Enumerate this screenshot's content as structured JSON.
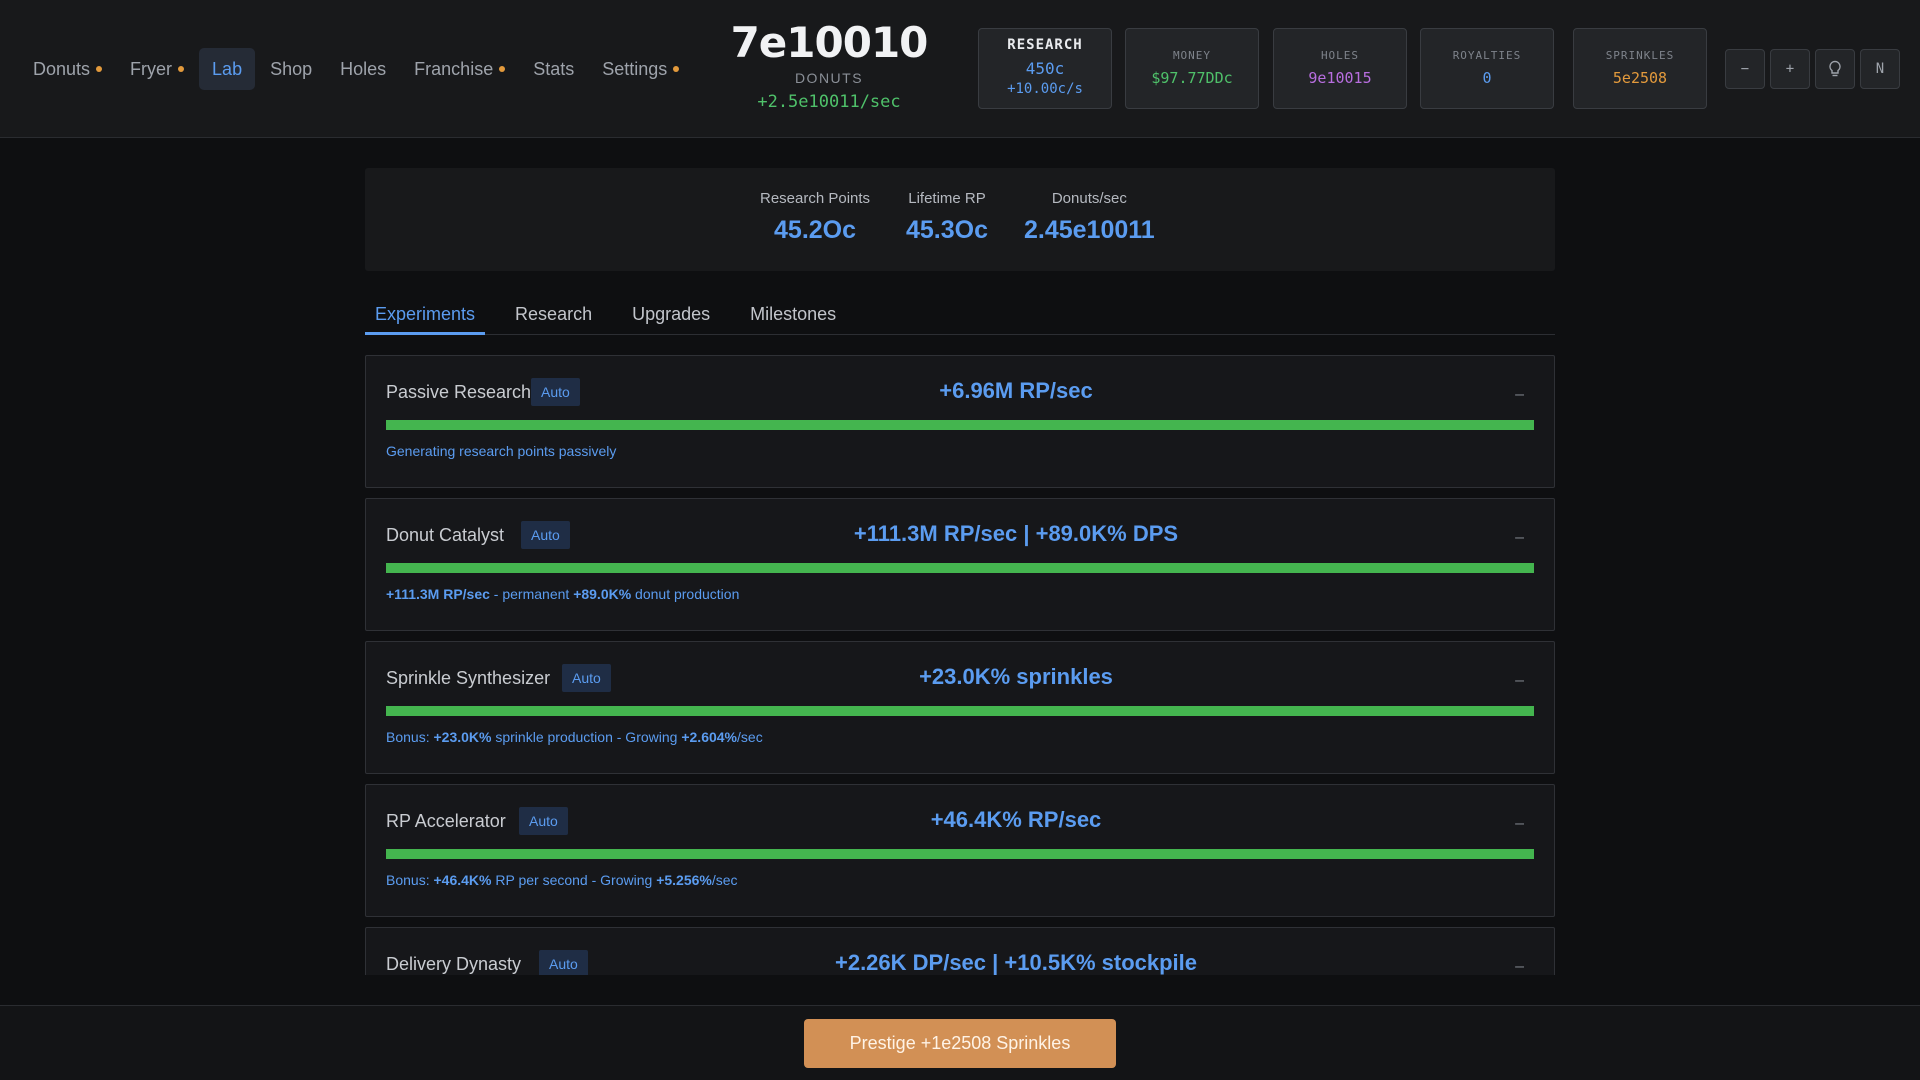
{
  "nav": [
    {
      "label": "Donuts",
      "dot": true,
      "active": false
    },
    {
      "label": "Fryer",
      "dot": true,
      "active": false
    },
    {
      "label": "Lab",
      "dot": false,
      "active": true
    },
    {
      "label": "Shop",
      "dot": false,
      "active": false
    },
    {
      "label": "Holes",
      "dot": false,
      "active": false
    },
    {
      "label": "Franchise",
      "dot": true,
      "active": false
    },
    {
      "label": "Stats",
      "dot": false,
      "active": false
    },
    {
      "label": "Settings",
      "dot": true,
      "active": false
    }
  ],
  "donuts": {
    "value": "7e10010",
    "label": "DONUTS",
    "rate": "+2.5e10011/sec"
  },
  "stats": {
    "research": {
      "label": "RESEARCH",
      "value": "450c",
      "rate": "+10.00c/s"
    },
    "money": {
      "label": "MONEY",
      "value": "$97.77DDc",
      "color": "#4fc16a"
    },
    "holes": {
      "label": "HOLES",
      "value": "9e10015",
      "color": "#b86ee0"
    },
    "royalties": {
      "label": "ROYALTIES",
      "value": "0",
      "color": "#5b9cf0"
    },
    "sprinkles": {
      "label": "SPRINKLES",
      "value": "5e2508",
      "color": "#e39a3c"
    }
  },
  "controls": [
    "−",
    "+",
    "lightbulb-icon",
    "N"
  ],
  "summary": {
    "research_points": {
      "label": "Research Points",
      "value": "45.2Oc"
    },
    "lifetime_rp": {
      "label": "Lifetime RP",
      "value": "45.3Oc"
    },
    "donuts_per_sec": {
      "label": "Donuts/sec",
      "value": "2.45e10011"
    }
  },
  "tabs": [
    {
      "label": "Experiments",
      "active": true
    },
    {
      "label": "Research",
      "active": false
    },
    {
      "label": "Upgrades",
      "active": false
    },
    {
      "label": "Milestones",
      "active": false
    }
  ],
  "experiments": [
    {
      "name": "Passive Research",
      "badge": "Auto",
      "effect": "+6.96M RP/sec",
      "progress": 1.0,
      "desc": [
        {
          "t": "Generating research points passively",
          "b": false
        }
      ]
    },
    {
      "name": "Donut Catalyst",
      "badge": "Auto",
      "effect": "+111.3M RP/sec | +89.0K% DPS",
      "progress": 1.0,
      "desc": [
        {
          "t": "+111.3M RP/sec",
          "b": true
        },
        {
          "t": " - permanent ",
          "b": false
        },
        {
          "t": "+89.0K%",
          "b": true
        },
        {
          "t": " donut production",
          "b": false
        }
      ]
    },
    {
      "name": "Sprinkle Synthesizer",
      "badge": "Auto",
      "effect": "+23.0K% sprinkles",
      "progress": 1.0,
      "desc": [
        {
          "t": "Bonus: ",
          "b": false
        },
        {
          "t": "+23.0K%",
          "b": true
        },
        {
          "t": " sprinkle production - Growing ",
          "b": false
        },
        {
          "t": "+2.604%",
          "b": true
        },
        {
          "t": "/sec",
          "b": false
        }
      ]
    },
    {
      "name": "RP Accelerator",
      "badge": "Auto",
      "effect": "+46.4K% RP/sec",
      "progress": 1.0,
      "desc": [
        {
          "t": "Bonus: ",
          "b": false
        },
        {
          "t": "+46.4K%",
          "b": true
        },
        {
          "t": " RP per second - Growing ",
          "b": false
        },
        {
          "t": "+5.256%",
          "b": true
        },
        {
          "t": "/sec",
          "b": false
        }
      ]
    },
    {
      "name": "Delivery Dynasty",
      "badge": "Auto",
      "effect": "+2.26K DP/sec | +10.5K% stockpile",
      "progress": 1.0,
      "desc": []
    }
  ],
  "collapse_symbol": "–",
  "prestige_label": "Prestige +1e2508 Sprinkles"
}
